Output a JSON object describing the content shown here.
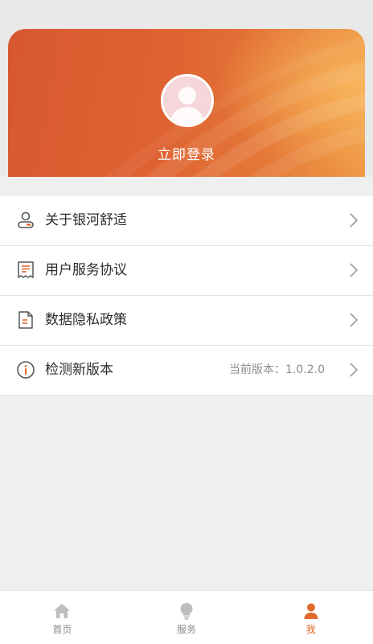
{
  "header": {
    "login_label": "立即登录"
  },
  "menu": {
    "items": [
      {
        "label": "关于银河舒适",
        "value": "",
        "icon": "user-card-icon"
      },
      {
        "label": "用户服务协议",
        "value": "",
        "icon": "document-list-icon"
      },
      {
        "label": "数据隐私政策",
        "value": "",
        "icon": "privacy-doc-icon"
      },
      {
        "label": "检测新版本",
        "value": "当前版本：1.0.2.0",
        "icon": "info-circle-icon"
      }
    ]
  },
  "tabbar": {
    "items": [
      {
        "label": "首页",
        "icon": "home-icon",
        "active": false
      },
      {
        "label": "服务",
        "icon": "lightbulb-icon",
        "active": false
      },
      {
        "label": "我",
        "icon": "person-icon",
        "active": true
      }
    ]
  },
  "colors": {
    "accent": "#e06b2c",
    "header_start": "#d7582f",
    "header_end": "#ef9a45",
    "background": "#efefef"
  }
}
